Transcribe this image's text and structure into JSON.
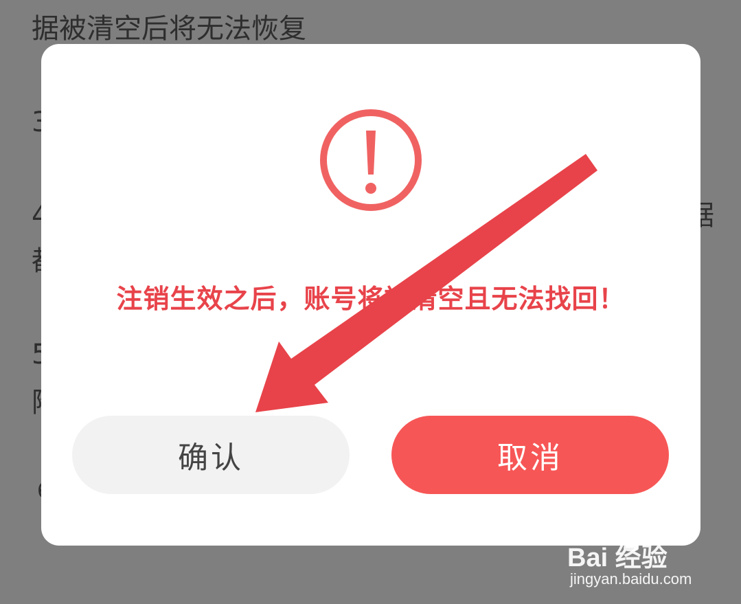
{
  "background": {
    "line_1": "据被清空后将无法恢复",
    "fragment_3": "3",
    "fragment_4": "4",
    "fragment_du": "都",
    "fragment_5": "5",
    "fragment_fu": "附",
    "fragment_6": "6",
    "fragment_ju": "据"
  },
  "dialog": {
    "icon": "exclamation-circle-icon",
    "warning_text": "注销生效之后，账号将被清空且无法找回！",
    "confirm_label": "确认",
    "cancel_label": "取消"
  },
  "annotation": {
    "icon": "red-arrow-icon",
    "color": "#e8434a"
  },
  "watermark": {
    "logo_text": "Bai  经验",
    "url": "jingyan.baidu.com"
  },
  "colors": {
    "accent_red": "#f75656",
    "warning_text": "#e8434a",
    "overlay": "#7f7f7f"
  }
}
